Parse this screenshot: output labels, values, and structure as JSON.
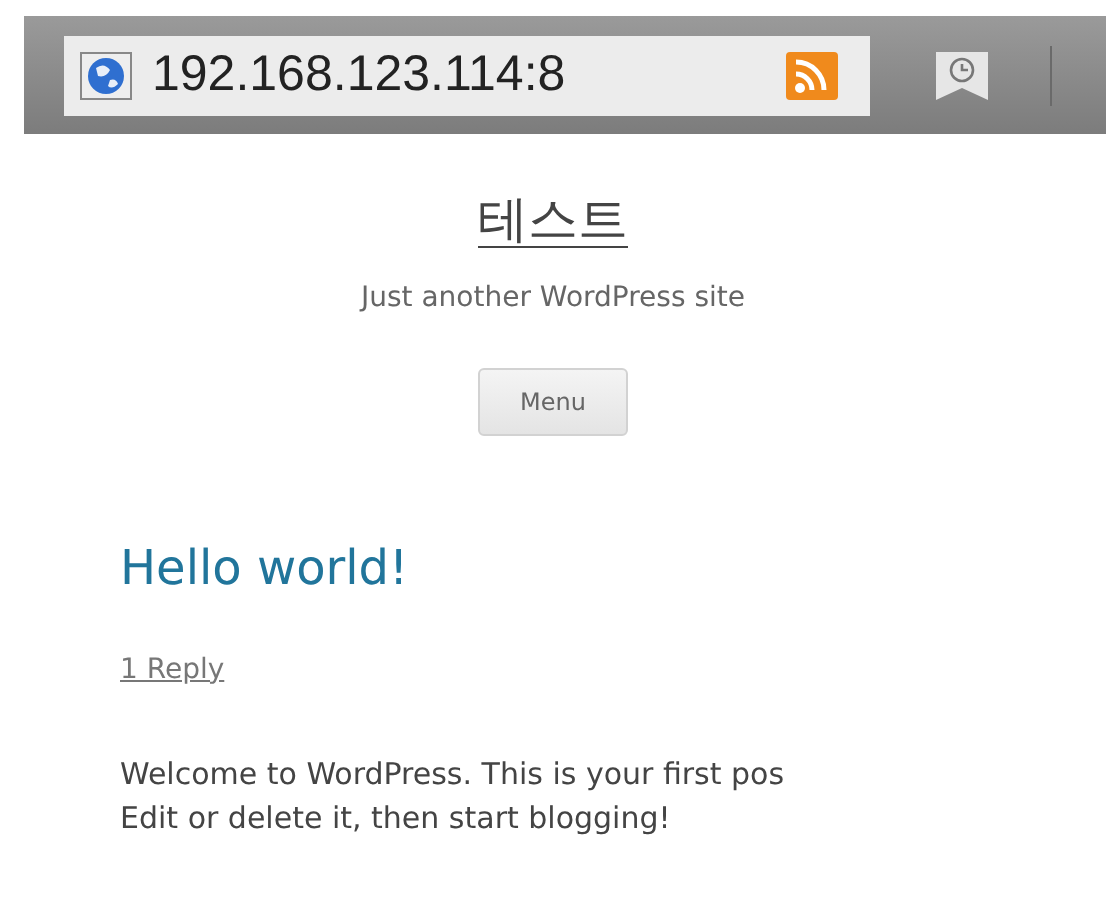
{
  "browser": {
    "address": "192.168.123.114:8"
  },
  "site": {
    "title": "테스트",
    "tagline": "Just another WordPress site",
    "menu_button": "Menu"
  },
  "post": {
    "title": "Hello world!",
    "replies": "1 Reply",
    "content": "Welcome to WordPress. This is your first pos\nEdit or delete it, then start blogging!"
  }
}
